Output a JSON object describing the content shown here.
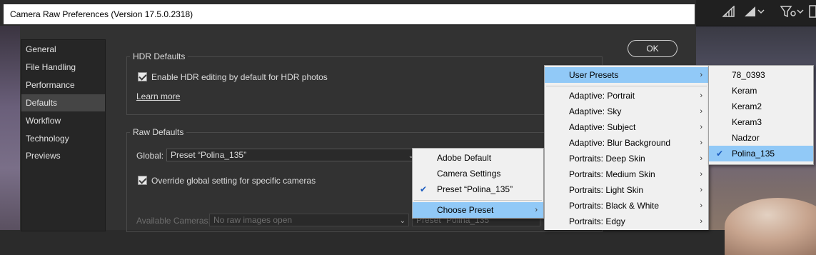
{
  "window": {
    "title": "Camera Raw Preferences  (Version 17.5.0.2318)"
  },
  "toolbar_icons": [
    "signal-bars-icon",
    "signal-bars-dropdown-icon",
    "filter-dropdown-icon",
    "more-icon"
  ],
  "sidebar": {
    "items": [
      {
        "label": "General"
      },
      {
        "label": "File Handling"
      },
      {
        "label": "Performance"
      },
      {
        "label": "Defaults",
        "active": true
      },
      {
        "label": "Workflow"
      },
      {
        "label": "Technology Previews"
      }
    ]
  },
  "hdr_defaults": {
    "title": "HDR Defaults",
    "enable_hdr_label": "Enable HDR editing by default for HDR photos",
    "enable_hdr_checked": true,
    "learn_more": "Learn more"
  },
  "raw_defaults": {
    "title": "Raw Defaults",
    "global_label": "Global:",
    "global_value": "Preset “Polina_135”",
    "override_label": "Override global setting for specific cameras",
    "override_checked": true,
    "available_cameras_label": "Available Cameras:",
    "available_cameras_value": "No raw images open",
    "camera_preset_value": "Preset “Polina_135”"
  },
  "ok_button": "OK",
  "menu_preset": {
    "items": [
      {
        "label": "Adobe Default"
      },
      {
        "label": "Camera Settings"
      },
      {
        "label": "Preset “Polina_135”",
        "checked": true
      },
      {
        "label": "Choose Preset",
        "submenu": true,
        "highlighted": true
      }
    ]
  },
  "menu_groups": {
    "items": [
      {
        "label": "User Presets",
        "highlighted": true
      },
      {
        "label": "Adaptive: Portrait"
      },
      {
        "label": "Adaptive: Sky"
      },
      {
        "label": "Adaptive: Subject"
      },
      {
        "label": "Adaptive: Blur Background"
      },
      {
        "label": "Portraits: Deep Skin"
      },
      {
        "label": "Portraits: Medium Skin"
      },
      {
        "label": "Portraits: Light Skin"
      },
      {
        "label": "Portraits: Black & White"
      },
      {
        "label": "Portraits: Edgy"
      }
    ]
  },
  "menu_user_presets": {
    "items": [
      {
        "label": "78_0393"
      },
      {
        "label": "Keram"
      },
      {
        "label": "Keram2"
      },
      {
        "label": "Keram3"
      },
      {
        "label": "Nadzor"
      },
      {
        "label": "Polina_135",
        "checked": true,
        "highlighted": true
      }
    ]
  },
  "colors": {
    "highlight": "#91c9f7",
    "check": "#1a5bbf"
  }
}
